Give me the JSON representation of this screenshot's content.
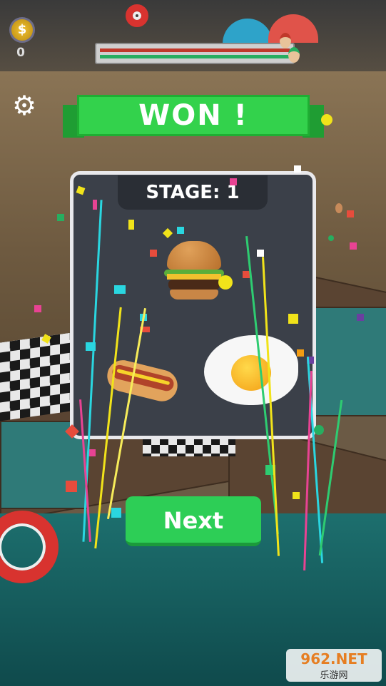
{
  "hud": {
    "coin_symbol": "$",
    "coin_count": "0",
    "settings_icon": "gear-icon"
  },
  "banner": {
    "title": "WON !"
  },
  "stage": {
    "label": "STAGE: 1",
    "foods": [
      "burger",
      "hotdog",
      "fried-egg"
    ]
  },
  "actions": {
    "next_label": "Next"
  },
  "watermark": {
    "main": "962.NET",
    "sub": "乐游网"
  },
  "colors": {
    "accent_green": "#33d24c",
    "button_green": "#2dce56",
    "panel_bg": "#3b4049",
    "panel_border": "#e9e9ec"
  }
}
